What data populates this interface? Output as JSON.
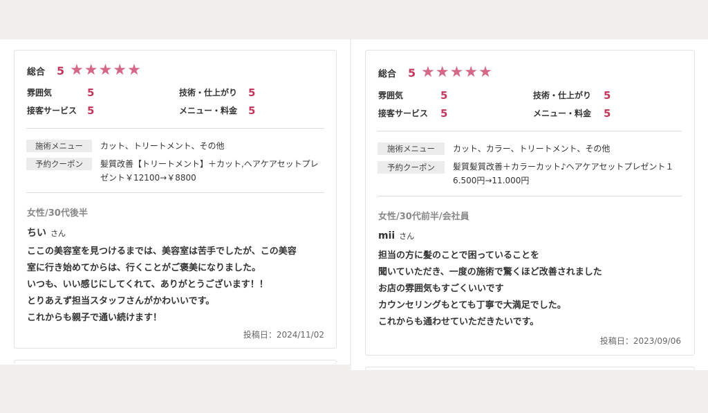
{
  "reviews": [
    {
      "overall_label": "総合",
      "overall_score": "5",
      "star_rating": 5,
      "ratings": [
        {
          "label": "雰囲気",
          "value": "5"
        },
        {
          "label": "技術・仕上がり",
          "value": "5"
        },
        {
          "label": "接客サービス",
          "value": "5"
        },
        {
          "label": "メニュー・料金",
          "value": "5"
        }
      ],
      "menu_label": "施術メニュー",
      "menu_value": "カット、トリートメント、その他",
      "coupon_label": "予約クーポン",
      "coupon_line1": "髪質改善【トリートメント】＋カット,ヘアケアセットプレ",
      "coupon_line2": "ゼント￥12100→￥8800",
      "reviewer_demo": "女性/30代後半",
      "reviewer_name": "ちい",
      "honorific": "さん",
      "body_lines": [
        "ここの美容室を見つけるまでは、美容室は苦手でしたが、この美容",
        "室に行き始めてからは、行くことがご褒美になりました。",
        "いつも、いい感じにしてくれて、ありがとうございます！！",
        "とりあえず担当スタッフさんがかわいいです。",
        "これからも親子で通い続けます！"
      ],
      "posted": "投稿日：2024/11/02"
    },
    {
      "overall_label": "総合",
      "overall_score": "5",
      "star_rating": 5,
      "ratings": [
        {
          "label": "雰囲気",
          "value": "5"
        },
        {
          "label": "技術・仕上がり",
          "value": "5"
        },
        {
          "label": "接客サービス",
          "value": "5"
        },
        {
          "label": "メニュー・料金",
          "value": "5"
        }
      ],
      "menu_label": "施術メニュー",
      "menu_value": "カット、カラー、トリートメント、その他",
      "coupon_label": "予約クーポン",
      "coupon_line1": "髪質髪質改善＋カラーカット♪ヘアケアセットプレゼント１",
      "coupon_line2": "6.500円→11.000円",
      "reviewer_demo": "女性/30代前半/会社員",
      "reviewer_name": "mii",
      "honorific": "さん",
      "body_lines": [
        "担当の方に髪のことで困っていることを",
        "聞いていただき、一度の施術で驚くほど改善されました",
        "お店の雰囲気もすごくいいです",
        "カウンセリングもとても丁寧で大満足でした。",
        "これからも通わせていただきたいです。"
      ],
      "posted": "投稿日：2023/09/06"
    }
  ],
  "colors": {
    "score": "#c2385c",
    "star": "#d56886",
    "tag_bg": "#ececec"
  }
}
